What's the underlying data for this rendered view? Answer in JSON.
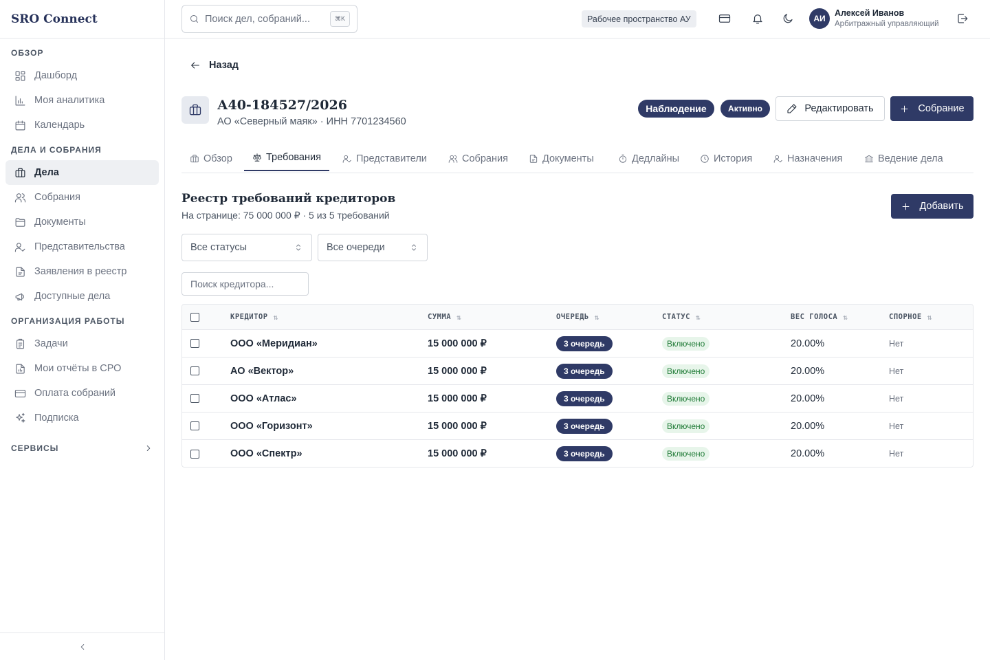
{
  "brand": "SRO Connect",
  "sidebar": {
    "sections": [
      {
        "title": "ОБЗОР",
        "items": [
          {
            "label": "Дашборд",
            "icon": "dashboard-icon"
          },
          {
            "label": "Моя аналитика",
            "icon": "analytics-icon"
          },
          {
            "label": "Календарь",
            "icon": "calendar-icon"
          }
        ]
      },
      {
        "title": "ДЕЛА И СОБРАНИЯ",
        "items": [
          {
            "label": "Дела",
            "icon": "briefcase-icon",
            "active": true
          },
          {
            "label": "Собрания",
            "icon": "users-icon"
          },
          {
            "label": "Документы",
            "icon": "folder-icon"
          },
          {
            "label": "Представительства",
            "icon": "user-check-icon"
          },
          {
            "label": "Заявления в реестр",
            "icon": "file-icon"
          },
          {
            "label": "Доступные дела",
            "icon": "megaphone-icon"
          }
        ]
      },
      {
        "title": "ОРГАНИЗАЦИЯ РАБОТЫ",
        "items": [
          {
            "label": "Задачи",
            "icon": "clipboard-icon"
          },
          {
            "label": "Мои отчёты в СРО",
            "icon": "report-icon"
          },
          {
            "label": "Оплата собраний",
            "icon": "credit-card-icon"
          },
          {
            "label": "Подписка",
            "icon": "sparkles-icon"
          }
        ]
      }
    ],
    "services": "СЕРВИСЫ"
  },
  "topbar": {
    "search_placeholder": "Поиск дел, собраний...",
    "shortcut": "⌘K",
    "workspace": "Рабочее пространство АУ",
    "user": {
      "initials": "АИ",
      "name": "Алексей Иванов",
      "role": "Арбитражный управляющий"
    }
  },
  "page": {
    "back": "Назад",
    "case_number": "А40-184527/2026",
    "case_subtitle": "АО «Северный маяк» · ИНН 7701234560",
    "procedure_badge": "Наблюдение",
    "status_badge": "Активно",
    "edit_label": "Редактировать",
    "meeting_label": "Собрание",
    "tabs": [
      {
        "label": "Обзор",
        "icon": "briefcase-icon"
      },
      {
        "label": "Требования",
        "icon": "scale-icon",
        "active": true
      },
      {
        "label": "Представители",
        "icon": "user-check-icon"
      },
      {
        "label": "Собрания",
        "icon": "users-icon"
      },
      {
        "label": "Документы",
        "icon": "file-icon"
      },
      {
        "label": "Дедлайны",
        "icon": "timer-icon"
      },
      {
        "label": "История",
        "icon": "clock-icon"
      },
      {
        "label": "Назначения",
        "icon": "user-check-icon"
      },
      {
        "label": "Ведение дела",
        "icon": "bank-icon"
      }
    ]
  },
  "registry": {
    "title": "Реестр требований кредиторов",
    "subtitle": "На странице: 75 000 000 ₽ · 5 из 5 требований",
    "add_label": "Добавить",
    "filter_status": "Все статусы",
    "filter_queue": "Все очереди",
    "search_placeholder": "Поиск кредитора...",
    "columns": [
      "КРЕДИТОР",
      "СУММА",
      "ОЧЕРЕДЬ",
      "СТАТУС",
      "ВЕС ГОЛОСА",
      "СПОРНОЕ"
    ],
    "rows": [
      {
        "creditor": "ООО «Меридиан»",
        "amount": "15 000 000 ₽",
        "queue": "3 очередь",
        "status": "Включено",
        "weight": "20.00%",
        "disputed": "Нет"
      },
      {
        "creditor": "АО «Вектор»",
        "amount": "15 000 000 ₽",
        "queue": "3 очередь",
        "status": "Включено",
        "weight": "20.00%",
        "disputed": "Нет"
      },
      {
        "creditor": "ООО «Атлас»",
        "amount": "15 000 000 ₽",
        "queue": "3 очередь",
        "status": "Включено",
        "weight": "20.00%",
        "disputed": "Нет"
      },
      {
        "creditor": "ООО «Горизонт»",
        "amount": "15 000 000 ₽",
        "queue": "3 очередь",
        "status": "Включено",
        "weight": "20.00%",
        "disputed": "Нет"
      },
      {
        "creditor": "ООО «Спектр»",
        "amount": "15 000 000 ₽",
        "queue": "3 очередь",
        "status": "Включено",
        "weight": "20.00%",
        "disputed": "Нет"
      }
    ]
  },
  "colors": {
    "primary": "#2f3a66",
    "success_bg": "#e7f5ea",
    "success_text": "#1e7a35"
  }
}
